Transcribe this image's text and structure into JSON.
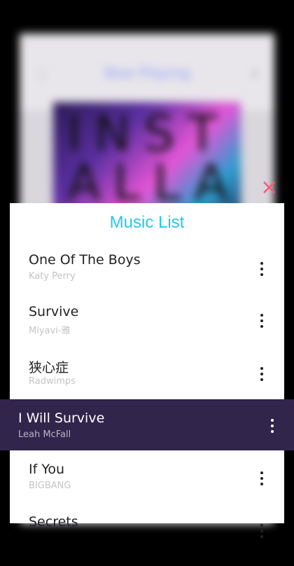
{
  "background": {
    "screen_title": "Now Playing",
    "menu_icon": "menu-icon",
    "search_icon": "search-icon",
    "art_text": "INST ALLA"
  },
  "dialog": {
    "title": "Music List",
    "close_icon": "close-icon",
    "accent_color": "#22c8f0",
    "close_color": "#ff5a7c"
  },
  "songs": [
    {
      "title": "One Of The Boys",
      "artist": "Katy Perry"
    },
    {
      "title": "Survive",
      "artist": "Miyavi-雅"
    },
    {
      "title": "狭心症",
      "artist": "Radwimps"
    },
    {
      "title": "I Will Survive",
      "artist": "Leah McFall",
      "active": true
    },
    {
      "title": "If You",
      "artist": "BIGBANG"
    },
    {
      "title": "Secrets",
      "artist": ""
    }
  ],
  "active_color": "#32254c"
}
